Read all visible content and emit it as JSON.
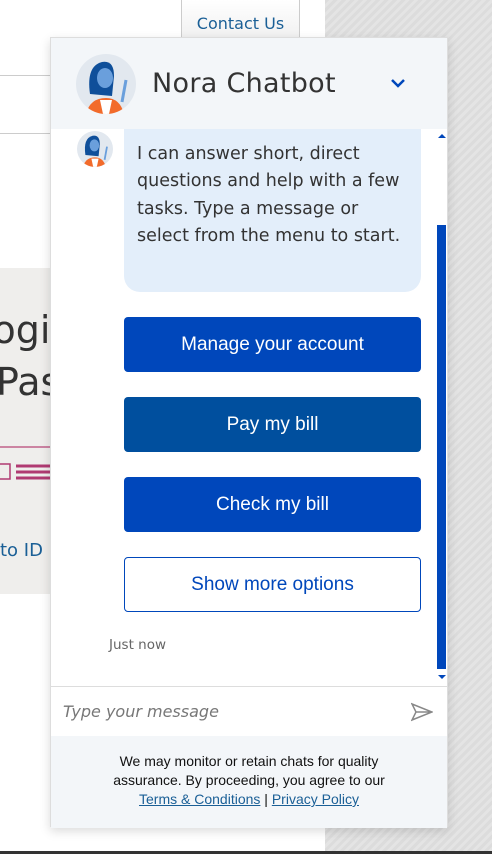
{
  "page": {
    "contact_label": "Contact Us",
    "promo_line1": "Login",
    "promo_line2": "Password",
    "promo_link": "to ID"
  },
  "chat": {
    "title": "Nora Chatbot",
    "message": "I can answer short, direct questions and help with a few tasks. Type a message or select from the menu to start.",
    "options": [
      "Manage your account",
      "Pay my bill",
      "Check my bill",
      "Show more options"
    ],
    "timestamp": "Just now",
    "input_placeholder": "Type your message",
    "disclaimer": "We may monitor or retain chats for quality assurance. By proceeding, you agree to our",
    "terms_label": "Terms & Conditions",
    "separator": "|",
    "privacy_label": "Privacy Policy"
  },
  "colors": {
    "primary": "#0047bb",
    "secondary": "#004f9e",
    "bubble": "#e3eefa",
    "header": "#f3f6f9"
  }
}
